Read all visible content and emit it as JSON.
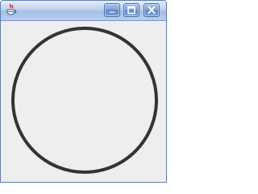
{
  "window": {
    "title": "",
    "icon": "java-cup-icon",
    "controls": {
      "minimize_icon": "minimize-icon",
      "maximize_icon": "maximize-icon",
      "close_icon": "close-icon"
    }
  },
  "canvas": {
    "shape": "circle",
    "stroke_color": "#333333",
    "fill": "none",
    "background": "#eeeeee"
  }
}
